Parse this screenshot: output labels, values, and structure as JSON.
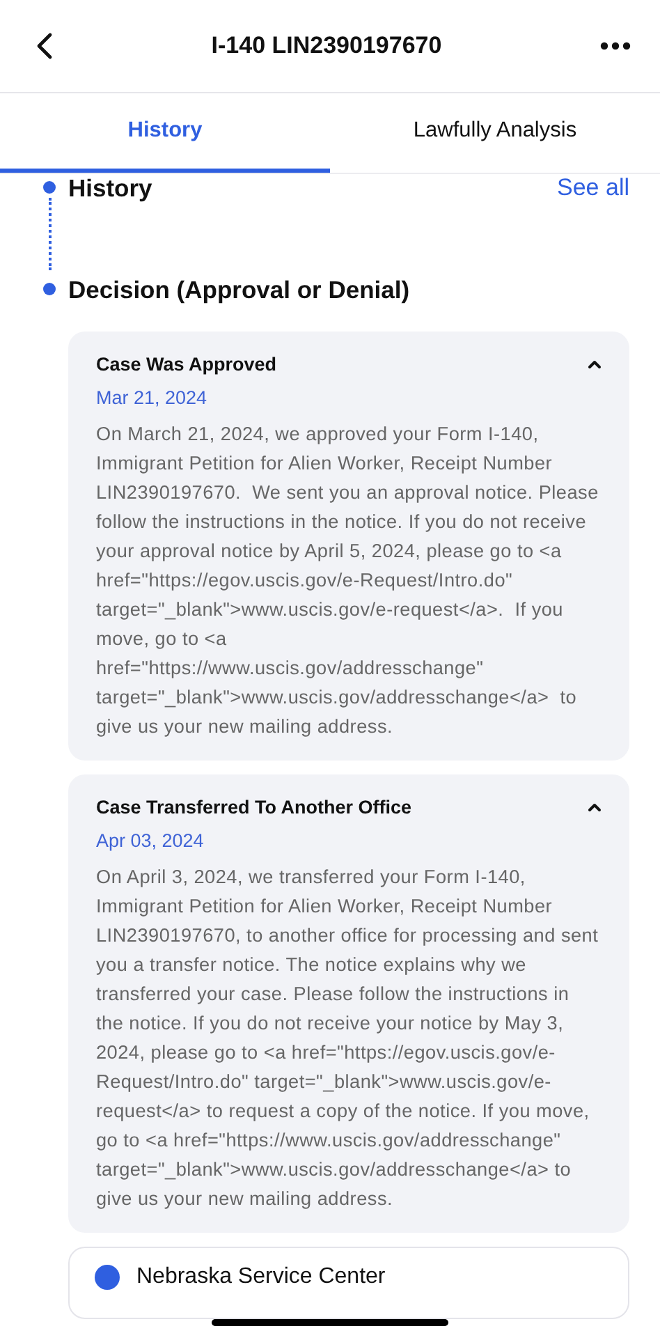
{
  "header": {
    "title": "I-140 LIN2390197670"
  },
  "tabs": [
    {
      "label": "History",
      "selected": true
    },
    {
      "label": "Lawfully Analysis",
      "selected": false
    }
  ],
  "timeline": {
    "steps": [
      {
        "title": "History",
        "link": "See all"
      },
      {
        "title": "Decision (Approval or Denial)"
      }
    ]
  },
  "events": [
    {
      "title": "Case Was Approved",
      "date": "Mar 21, 2024",
      "expanded": true,
      "body": "On March 21, 2024, we approved your Form I-140, Immigrant Petition for Alien Worker, Receipt Number LIN2390197670.  We sent you an approval notice. Please follow the instructions in the notice. If you do not receive your approval notice by April 5, 2024, please go to <a href=\"https://egov.uscis.gov/e-Request/Intro.do\" target=\"_blank\">www.uscis.gov/e-request</a>.  If you move, go to <a href=\"https://www.uscis.gov/addresschange\" target=\"_blank\">www.uscis.gov/addresschange</a>  to give us your new mailing address."
    },
    {
      "title": "Case Transferred To Another Office",
      "date": "Apr 03, 2024",
      "expanded": true,
      "body": "On April 3, 2024, we transferred your Form I-140, Immigrant Petition for Alien Worker, Receipt Number LIN2390197670, to another office for processing and sent you a transfer notice. The notice explains why we transferred your case. Please follow the instructions in the notice. If you do not receive your notice by May 3, 2024, please go to <a href=\"https://egov.uscis.gov/e-Request/Intro.do\" target=\"_blank\">www.uscis.gov/e-request</a> to request a copy of the notice. If you move, go to <a href=\"https://www.uscis.gov/addresschange\" target=\"_blank\">www.uscis.gov/addresschange</a> to give us your new mailing address."
    }
  ],
  "office": {
    "name": "Nebraska Service Center"
  }
}
